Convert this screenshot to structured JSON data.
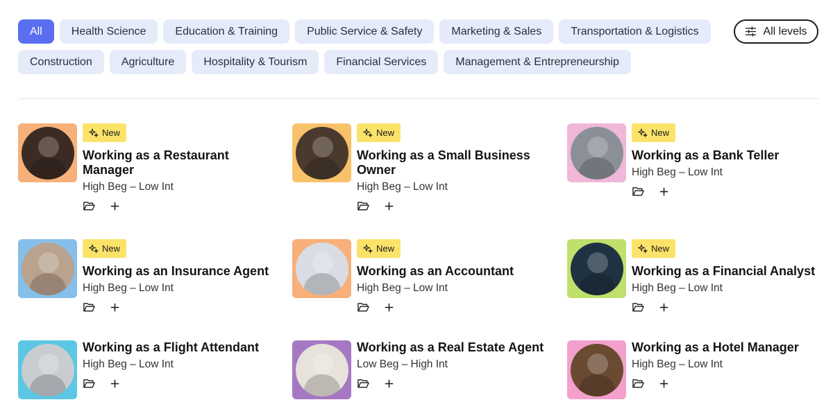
{
  "filters": {
    "row1": [
      "All",
      "Health Science",
      "Education & Training",
      "Public Service & Safety",
      "Marketing & Sales",
      "Transportation & Logistics"
    ],
    "row2": [
      "Construction",
      "Agriculture",
      "Hospitality & Tourism",
      "Financial Services",
      "Management & Entrepreneurship"
    ],
    "active": "All"
  },
  "levels_button": {
    "label": "All levels",
    "icon": "sliders-icon"
  },
  "badge_label": "New",
  "cards": [
    {
      "title": "Working as a Restaurant Manager",
      "level": "High Beg – Low Int",
      "is_new": true,
      "thumb_color": "#f7b07a",
      "photo_color": "#3b2b24"
    },
    {
      "title": "Working as a Small Business Owner",
      "level": "High Beg – Low Int",
      "is_new": true,
      "thumb_color": "#f8c26a",
      "photo_color": "#4a3a2e"
    },
    {
      "title": "Working as a Bank Teller",
      "level": "High Beg – Low Int",
      "is_new": true,
      "thumb_color": "#efb7d8",
      "photo_color": "#8a8f98"
    },
    {
      "title": "Working as an Insurance Agent",
      "level": "High Beg – Low Int",
      "is_new": true,
      "thumb_color": "#86bfe9",
      "photo_color": "#b9a28e"
    },
    {
      "title": "Working as an Accountant",
      "level": "High Beg – Low Int",
      "is_new": true,
      "thumb_color": "#f7b07a",
      "photo_color": "#d9dde3"
    },
    {
      "title": "Working as a Financial Analyst",
      "level": "High Beg – Low Int",
      "is_new": true,
      "thumb_color": "#bfe06a",
      "photo_color": "#1f3242"
    },
    {
      "title": "Working as a Flight Attendant",
      "level": "High Beg – Low Int",
      "is_new": false,
      "thumb_color": "#5cc7e2",
      "photo_color": "#c9ccd1"
    },
    {
      "title": "Working as a Real Estate Agent",
      "level": "Low Beg – High Int",
      "is_new": false,
      "thumb_color": "#a678c4",
      "photo_color": "#e7e2da"
    },
    {
      "title": "Working as a Hotel Manager",
      "level": "High Beg – Low Int",
      "is_new": false,
      "thumb_color": "#f3a0cc",
      "photo_color": "#6b4a32"
    }
  ],
  "card_icons": {
    "save": "folder-icon",
    "add": "plus-icon",
    "badge": "sparkle-icon"
  }
}
